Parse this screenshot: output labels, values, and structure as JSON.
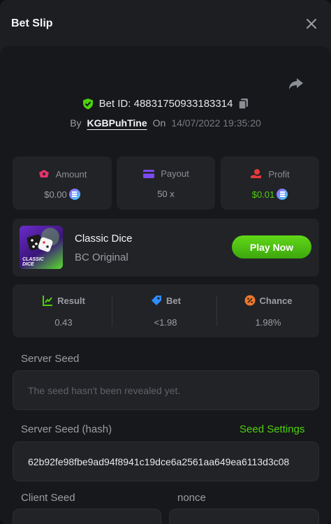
{
  "header": {
    "title": "Bet Slip"
  },
  "bet": {
    "id_label": "Bet ID: 48831750933183314",
    "by": "By",
    "user": "KGBPuhTine",
    "on": "On",
    "date": "14/07/2022 19:35:20"
  },
  "stats": {
    "amount": {
      "label": "Amount",
      "value": "$0.00"
    },
    "payout": {
      "label": "Payout",
      "value": "50 x"
    },
    "profit": {
      "label": "Profit",
      "value": "$0.01"
    }
  },
  "game": {
    "name": "Classic Dice",
    "subtitle": "BC Original",
    "thumb_text": "CLASSIC DICE",
    "play_label": "Play Now"
  },
  "result": {
    "result": {
      "label": "Result",
      "value": "0.43"
    },
    "bet": {
      "label": "Bet",
      "value": "<1.98"
    },
    "chance": {
      "label": "Chance",
      "value": "1.98%"
    }
  },
  "seeds": {
    "server_seed_label": "Server Seed",
    "server_seed_placeholder": "The seed hasn't been revealed yet.",
    "server_hash_label": "Server Seed (hash)",
    "seed_settings": "Seed Settings",
    "server_hash_value": "62b92fe98fbe9ad94f8941c19dce6a2561aa649ea6113d3c08",
    "client_seed_label": "Client Seed",
    "nonce_label": "nonce"
  },
  "colors": {
    "accent_green": "#4ed10c",
    "amount_pink": "#e8336d",
    "payout_purple": "#7b4bf0",
    "profit_red": "#e53b3b",
    "chance_orange": "#f0782a",
    "bet_blue": "#2f8cff"
  },
  "icons": [
    "close-icon",
    "share-icon",
    "shield-check-icon",
    "copy-icon",
    "amount-icon",
    "payout-icon",
    "profit-icon",
    "result-icon",
    "bet-icon",
    "chance-icon",
    "coin-icon"
  ]
}
